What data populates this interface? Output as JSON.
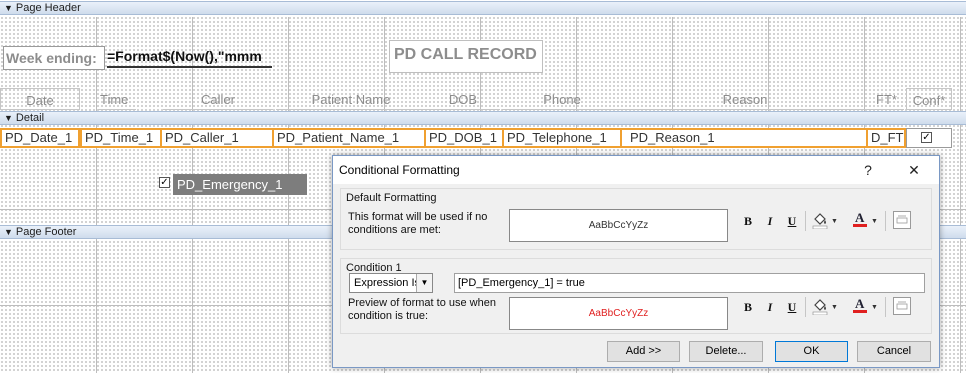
{
  "sections": {
    "page_header": "Page Header",
    "detail": "Detail",
    "page_footer": "Page Footer"
  },
  "header": {
    "week_label": "Week ending:",
    "week_expr": "=Format$(Now(),\"mmm",
    "title": "PD CALL RECORD",
    "columns": [
      "Date",
      "Time",
      "Caller",
      "Patient Name",
      "DOB",
      "Phone",
      "Reason",
      "FT*",
      "Conf*"
    ]
  },
  "detail": {
    "fields": [
      "PD_Date_1",
      "PD_Time_1",
      "PD_Caller_1",
      "PD_Patient_Name_1",
      "PD_DOB_1",
      "PD_Telephone_1",
      "PD_Reason_1",
      "D_FT"
    ],
    "emergency_label": "PD_Emergency_1"
  },
  "dialog": {
    "title": "Conditional Formatting",
    "help": "?",
    "close": "✕",
    "default_group": {
      "title": "Default Formatting",
      "description": "This format will be used if no conditions are met:",
      "preview_text": "AaBbCcYyZz",
      "preview_color": "#333333"
    },
    "condition_group": {
      "title": "Condition 1",
      "type_value": "Expression Is",
      "expression": "[PD_Emergency_1] = true",
      "description": "Preview of format to use when condition is true:",
      "preview_text": "AaBbCcYyZz",
      "preview_color": "#e02020"
    },
    "format_buttons": {
      "bold": "B",
      "italic": "I",
      "underline": "U"
    },
    "buttons": {
      "add": "Add >>",
      "delete": "Delete...",
      "ok": "OK",
      "cancel": "Cancel"
    }
  },
  "colors": {
    "field_border": "#f0a030",
    "section_bar": "#cfdcec",
    "fill_icon": "#ffffff",
    "font_color_bar": "#e02020"
  }
}
